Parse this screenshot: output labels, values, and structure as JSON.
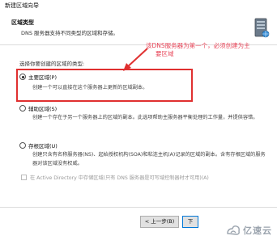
{
  "window": {
    "title": "新建区域向导"
  },
  "header": {
    "title": "区域类型",
    "description": "DNS 服务器支持不同类型的区域和存储。"
  },
  "main": {
    "prompt": "选择你要创建的区域的类型:",
    "options": [
      {
        "label": "主要区域(P)",
        "selected": true,
        "description": "创建一个可以直接在这个服务器上更新的区域副本。"
      },
      {
        "label": "辅助区域(S)",
        "selected": false,
        "description": "创建一个存在于另一个服务器上的区域的副本。此选项帮助主服务器平衡处理的工作量，并提供容错。"
      },
      {
        "label": "存根区域(U)",
        "selected": false,
        "description": "创建只含有名称服务器(NS)、起始授权机构(SOA)和粘连主机(A)记录的区域的副本。含有存根区域的服务器对该区域没有权威。"
      }
    ],
    "ad_checkbox": {
      "label": "在 Active Directory 中存储区域(只有 DNS 服务器是可写域控制器时才可用)(A)",
      "checked": false,
      "enabled": false
    }
  },
  "annotation": {
    "line1": "该DNS服务器为第一个，必须创建为主",
    "line2": "要区域",
    "color": "#e8475a"
  },
  "footer": {
    "back_label": "< 上一步(B)",
    "next_label": "下"
  },
  "watermark": {
    "text": "亿速云"
  }
}
